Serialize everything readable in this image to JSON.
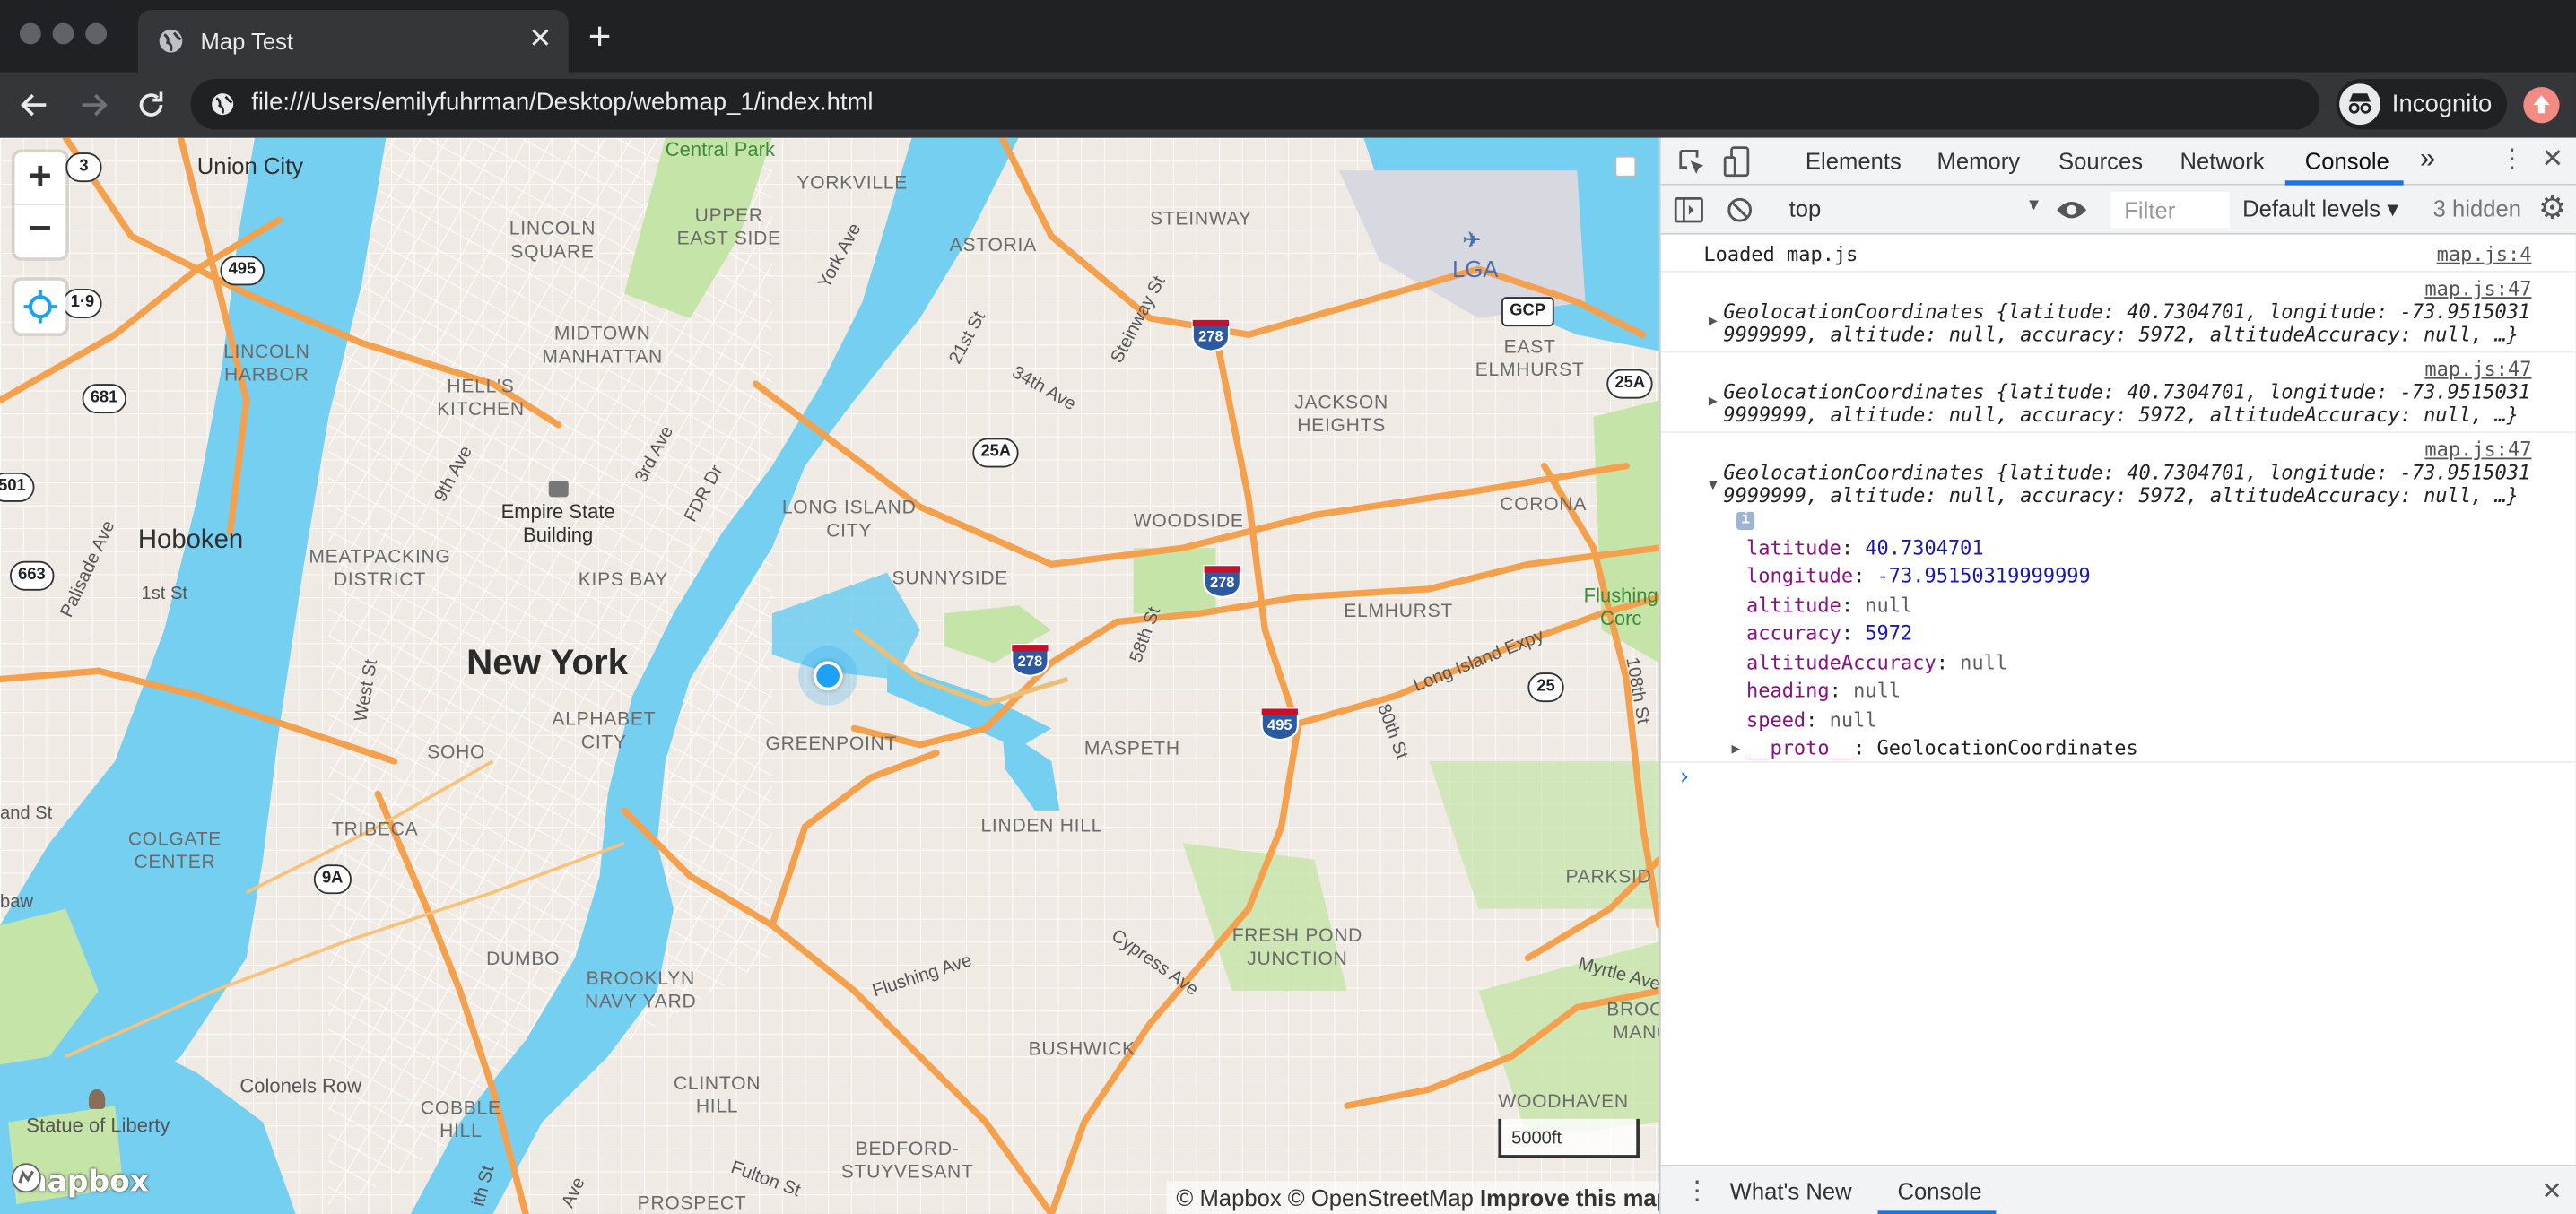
{
  "browser": {
    "tab_title": "Map Test",
    "url": "file:///Users/emilyfuhrman/Desktop/webmap_1/index.html",
    "incognito_label": "Incognito"
  },
  "map": {
    "labels": {
      "union_city": "Union City",
      "central_park": "Central Park",
      "yorkville": "YORKVILLE",
      "steinway": "STEINWAY",
      "lincoln_square": "LINCOLN\nSQUARE",
      "upper_east_side": "UPPER\nEAST SIDE",
      "astoria": "ASTORIA",
      "lga": "LGA",
      "midtown": "MIDTOWN\nMANHATTAN",
      "east_elmhurst": "EAST\nELMHURST",
      "lincoln_harbor": "LINCOLN\nHARBOR",
      "hells_kitchen": "HELL'S\nKITCHEN",
      "jackson_heights": "JACKSON\nHEIGHTS",
      "long_island_city": "LONG ISLAND\nCITY",
      "woodside": "WOODSIDE",
      "corona": "CORONA",
      "hoboken": "Hoboken",
      "empire_state": "Empire State\nBuilding",
      "meatpacking": "MEATPACKING\nDISTRICT",
      "kips_bay": "KIPS BAY",
      "sunnyside": "SUNNYSIDE",
      "elmhurst": "ELMHURST",
      "flushing": "Flushing\nCorc",
      "new_york": "New York",
      "alphabet_city": "ALPHABET\nCITY",
      "greenpoint": "GREENPOINT",
      "maspeth": "MASPETH",
      "soho": "SOHO",
      "tribeca": "TRIBECA",
      "colgate_center": "COLGATE\nCENTER",
      "linden_hill": "LINDEN HILL",
      "parksid": "PARKSID",
      "fresh_pond": "FRESH POND\nJUNCTION",
      "dumbo": "DUMBO",
      "brooklyn_navy_yard": "BROOKLYN\nNAVY YARD",
      "bushwick": "BUSHWICK",
      "brooklyn_manor": "BROOK\nMANO",
      "colonels_row": "Colonels Row",
      "statue_of_liberty": "Statue of Liberty",
      "clinton_hill": "CLINTON\nHILL",
      "cobble_hill": "COBBLE\nHILL",
      "woodhaven": "WOODHAVEN",
      "bedford": "BEDFORD-\nSTUYVESANT",
      "prospect": "PROSPECT",
      "york_ave": "York Ave",
      "st_21": "21st St",
      "steinway_st": "Steinway St",
      "ave_34": "34th Ave",
      "ave_9": "9th Ave",
      "ave_3": "3rd Ave",
      "fdr": "FDR Dr",
      "palisade": "Palisade Ave",
      "st_1": "1st St",
      "west_st": "West St",
      "st_58": "58th St",
      "st_80": "80th St",
      "lie": "Long Island Expy",
      "st_108": "108th St",
      "flushing_ave": "Flushing Ave",
      "cypress_ave": "Cypress Ave",
      "myrtle_ave": "Myrtle Ave",
      "fulton_st": "Fulton St",
      "and_st": "and St",
      "baw": "baw",
      "ith_st": "ith St",
      "ave_suffix": "Ave"
    },
    "shields": {
      "s3": "3",
      "s495": "495",
      "s19": "1·9",
      "s681": "681",
      "s501": "501",
      "s663": "663",
      "s25a_1": "25A",
      "s25a_2": "25A",
      "gcp": "GCP",
      "s25": "25",
      "s9a": "9A"
    },
    "interstates": {
      "i278_a": "278",
      "i278_b": "278",
      "i278_c": "278",
      "i495": "495"
    },
    "controls": {
      "zoom_in": "+",
      "zoom_out": "−"
    },
    "scale_label": "5000ft",
    "attribution": {
      "mapbox": "© Mapbox",
      "osm": "© OpenStreetMap",
      "improve": "Improve this map"
    },
    "logo_text": "mapbox",
    "colors": {
      "land": "#efeae3",
      "water": "#75cff0",
      "highway": "#f5a04d",
      "park": "#c5e4a8",
      "location_dot": "#1da1f2"
    }
  },
  "devtools": {
    "tabs": [
      "Elements",
      "Memory",
      "Sources",
      "Network",
      "Console"
    ],
    "active_tab": "Console",
    "more": "»",
    "context": "top",
    "filter_placeholder": "Filter",
    "levels": "Default levels ▾",
    "hidden": "3 hidden",
    "messages": [
      {
        "text": "Loaded map.js",
        "source": "map.js:4"
      },
      {
        "source": "map.js:47",
        "line1": "GeolocationCoordinates {latitude: 40.7304701, longitude: -73.9515031",
        "line2": "9999999, altitude: null, accuracy: 5972, altitudeAccuracy: null, …}"
      },
      {
        "source": "map.js:47",
        "line1": "GeolocationCoordinates {latitude: 40.7304701, longitude: -73.9515031",
        "line2": "9999999, altitude: null, accuracy: 5972, altitudeAccuracy: null, …}"
      },
      {
        "source": "map.js:47",
        "line1": "GeolocationCoordinates {latitude: 40.7304701, longitude: -73.9515031",
        "line2": "9999999, altitude: null, accuracy: 5972, altitudeAccuracy: null, …}"
      }
    ],
    "expanded": {
      "latitude": {
        "key": "latitude",
        "value": "40.7304701"
      },
      "longitude": {
        "key": "longitude",
        "value": "-73.95150319999999"
      },
      "altitude": {
        "key": "altitude",
        "value": "null"
      },
      "accuracy": {
        "key": "accuracy",
        "value": "5972"
      },
      "altitudeAccuracy": {
        "key": "altitudeAccuracy",
        "value": "null"
      },
      "heading": {
        "key": "heading",
        "value": "null"
      },
      "speed": {
        "key": "speed",
        "value": "null"
      },
      "proto": {
        "key": "__proto__",
        "value": "GeolocationCoordinates"
      }
    },
    "prompt": "›",
    "drawer_tabs": [
      "What's New",
      "Console"
    ]
  }
}
